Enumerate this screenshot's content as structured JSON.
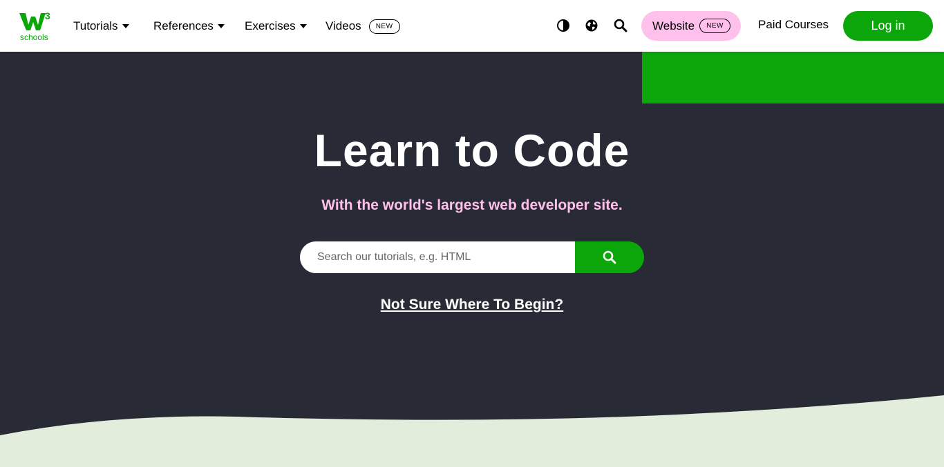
{
  "logo": {
    "text": "schools",
    "superscript": "3",
    "color": "#04AA6D"
  },
  "nav": {
    "tutorials": "Tutorials",
    "references": "References",
    "exercises": "Exercises",
    "videos": "Videos",
    "videos_badge": "NEW"
  },
  "toolbar": {
    "contrast_icon": "contrast-icon",
    "globe_icon": "globe-icon",
    "search_icon": "search-icon"
  },
  "website": {
    "label": "Website",
    "badge": "NEW"
  },
  "paid_courses": "Paid Courses",
  "login": "Log in",
  "hero": {
    "title": "Learn to Code",
    "subtitle": "With the world's largest web developer site.",
    "search_placeholder": "Search our tutorials, e.g. HTML",
    "begin_link": "Not Sure Where To Begin?"
  },
  "colors": {
    "brand_green": "#0AA60A",
    "hero_bg": "#282A35",
    "pink": "#FFC0EB",
    "wave": "#E2EEDB"
  }
}
